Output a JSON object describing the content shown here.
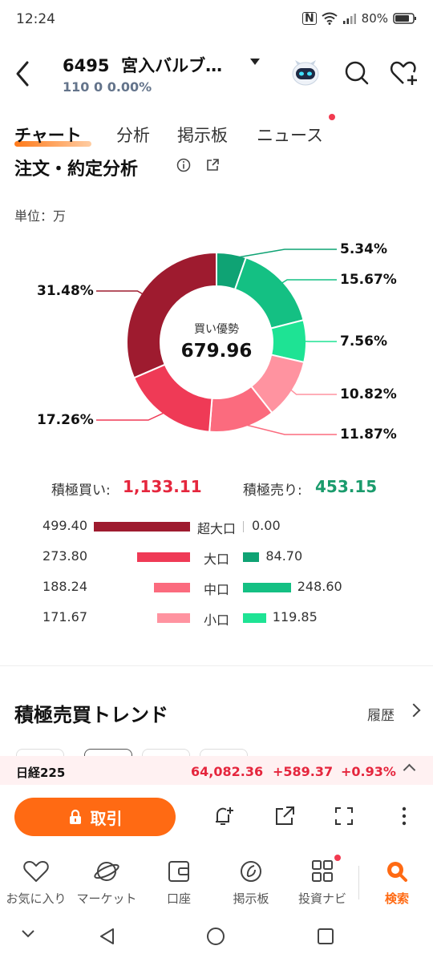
{
  "status": {
    "time": "12:24",
    "battery": "80%"
  },
  "header": {
    "code": "6495",
    "name": "宮入バルブ…",
    "price": "110",
    "change": "0",
    "change_pct": "0.00%"
  },
  "tabs": [
    {
      "label": "チャート",
      "active": true
    },
    {
      "label": "分析",
      "active": false
    },
    {
      "label": "掲示板",
      "active": false
    },
    {
      "label": "ニュース",
      "active": false,
      "badge": true
    }
  ],
  "section": {
    "title": "注文・約定分析",
    "unit": "単位：万"
  },
  "donut": {
    "center_label": "買い優勢",
    "center_value": "679.96",
    "segments": [
      {
        "name": "sell-super-large",
        "pct": 5.34,
        "label": "5.34%",
        "color": "#0fa374"
      },
      {
        "name": "sell-large",
        "pct": 15.67,
        "label": "15.67%",
        "color": "#14c083"
      },
      {
        "name": "sell-medium",
        "pct": 7.56,
        "label": "7.56%",
        "color": "#1ee394"
      },
      {
        "name": "buy-small",
        "pct": 10.82,
        "label": "10.82%",
        "color": "#ff93a0"
      },
      {
        "name": "buy-medium",
        "pct": 11.87,
        "label": "11.87%",
        "color": "#fb6b7e"
      },
      {
        "name": "buy-large",
        "pct": 17.26,
        "label": "17.26%",
        "color": "#ef3a56"
      },
      {
        "name": "buy-super-large",
        "pct": 31.48,
        "label": "31.48%",
        "color": "#9e1b2f"
      }
    ]
  },
  "totals": {
    "buy_label": "積極買い:",
    "buy_value": "1,133.11",
    "sell_label": "積極売り:",
    "sell_value": "453.15"
  },
  "rows": [
    {
      "label": "超大口",
      "buy": "499.40",
      "buy_value": 499.4,
      "sell": "0.00",
      "sell_value": 0.0,
      "buy_color": "#9e1b2f",
      "sell_color": "#0fa374"
    },
    {
      "label": "大口",
      "buy": "273.80",
      "buy_value": 273.8,
      "sell": "84.70",
      "sell_value": 84.7,
      "buy_color": "#ef3a56",
      "sell_color": "#0fa374"
    },
    {
      "label": "中口",
      "buy": "188.24",
      "buy_value": 188.24,
      "sell": "248.60",
      "sell_value": 248.6,
      "buy_color": "#fb6b7e",
      "sell_color": "#14c083"
    },
    {
      "label": "小口",
      "buy": "171.67",
      "buy_value": 171.67,
      "sell": "119.85",
      "sell_value": 119.85,
      "buy_color": "#ff93a0",
      "sell_color": "#1ee394"
    }
  ],
  "trend": {
    "title": "積極売買トレンド",
    "history": "履歴"
  },
  "index": {
    "name": "日経225",
    "value": "64,082.36",
    "change": "+589.37",
    "change_pct": "+0.93%"
  },
  "actions": {
    "trade": "取引"
  },
  "nav": [
    {
      "label": "お気に入り",
      "icon": "heart-icon"
    },
    {
      "label": "マーケット",
      "icon": "planet-icon"
    },
    {
      "label": "口座",
      "icon": "wallet-icon"
    },
    {
      "label": "掲示板",
      "icon": "board-icon"
    },
    {
      "label": "投資ナビ",
      "icon": "grid-icon"
    },
    {
      "label": "検索",
      "icon": "search-icon",
      "active": true
    }
  ]
}
